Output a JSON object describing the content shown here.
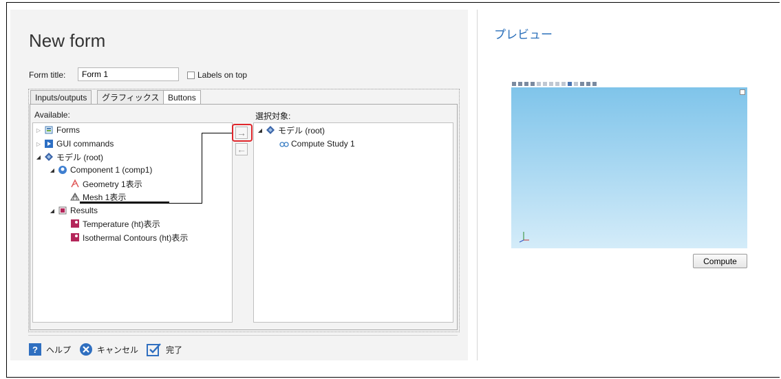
{
  "form": {
    "title": "New form",
    "form_title_label": "Form title:",
    "form_title_value": "Form 1",
    "labels_on_top": "Labels on top"
  },
  "tabs": [
    {
      "label": "Inputs/outputs"
    },
    {
      "label": "グラフィックス"
    },
    {
      "label": "Buttons"
    }
  ],
  "available": {
    "label": "Available:",
    "items": [
      {
        "label": "Forms"
      },
      {
        "label": "GUI commands"
      },
      {
        "label": "モデル (root)"
      },
      {
        "label": "Component 1 (comp1)"
      },
      {
        "label": "Geometry 1表示"
      },
      {
        "label": "Mesh 1表示"
      },
      {
        "label": "Results"
      },
      {
        "label": "Temperature (ht)表示"
      },
      {
        "label": "Isothermal Contours (ht)表示"
      }
    ]
  },
  "selected": {
    "label": "選択対象:",
    "items": [
      {
        "label": "モデル (root)"
      },
      {
        "label": "Compute Study 1"
      }
    ]
  },
  "bottom": {
    "help": "ヘルプ",
    "cancel": "キャンセル",
    "done": "完了"
  },
  "preview": {
    "title": "プレビュー",
    "compute_button": "Compute"
  },
  "colors": {
    "accent": "#2a6fba",
    "highlight": "#e0262b",
    "canvas_top": "#7fc4ea",
    "canvas_bottom": "#d4ecf9"
  }
}
